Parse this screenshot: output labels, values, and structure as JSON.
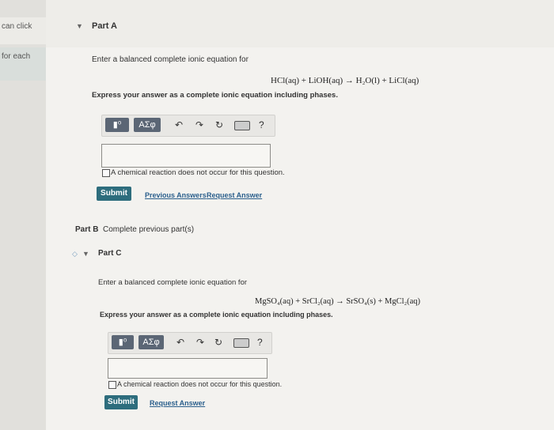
{
  "sidebar": {
    "snippet_1": "can click",
    "snippet_2": "for each"
  },
  "part_a": {
    "title": "Part A",
    "prompt": "Enter a balanced complete ionic equation for",
    "equation": "HCl(aq) + LiOH(aq) → H₂O(l) + LiCl(aq)",
    "express": "Express your answer as a complete ionic equation including phases.",
    "toolbar": {
      "template_icon": "template-icon",
      "greek_label": "ΑΣφ",
      "undo_icon": "undo-icon",
      "redo_icon": "redo-icon",
      "reset_icon": "reset-icon",
      "keyboard_icon": "keyboard-icon",
      "help_label": "?"
    },
    "answer_value": "",
    "no_reaction_label": "A chemical reaction does not occur for this question.",
    "submit_label": "Submit",
    "previous_answers_label": "Previous Answers",
    "request_answer_label": "Request Answer"
  },
  "part_b": {
    "label": "Part B",
    "status": "Complete previous part(s)"
  },
  "part_c": {
    "title": "Part C",
    "prompt": "Enter a balanced complete ionic equation for",
    "equation": "MgSO₄(aq) + SrCl₂(aq) → SrSO₄(s) + MgCl₂(aq)",
    "express": "Express your answer as a complete ionic equation including phases.",
    "toolbar": {
      "template_icon": "template-icon",
      "greek_label": "ΑΣφ",
      "undo_icon": "undo-icon",
      "redo_icon": "redo-icon",
      "reset_icon": "reset-icon",
      "keyboard_icon": "keyboard-icon",
      "help_label": "?"
    },
    "answer_value": "",
    "no_reaction_label": "A chemical reaction does not occur for this question.",
    "submit_label": "Submit",
    "request_answer_label": "Request Answer"
  }
}
